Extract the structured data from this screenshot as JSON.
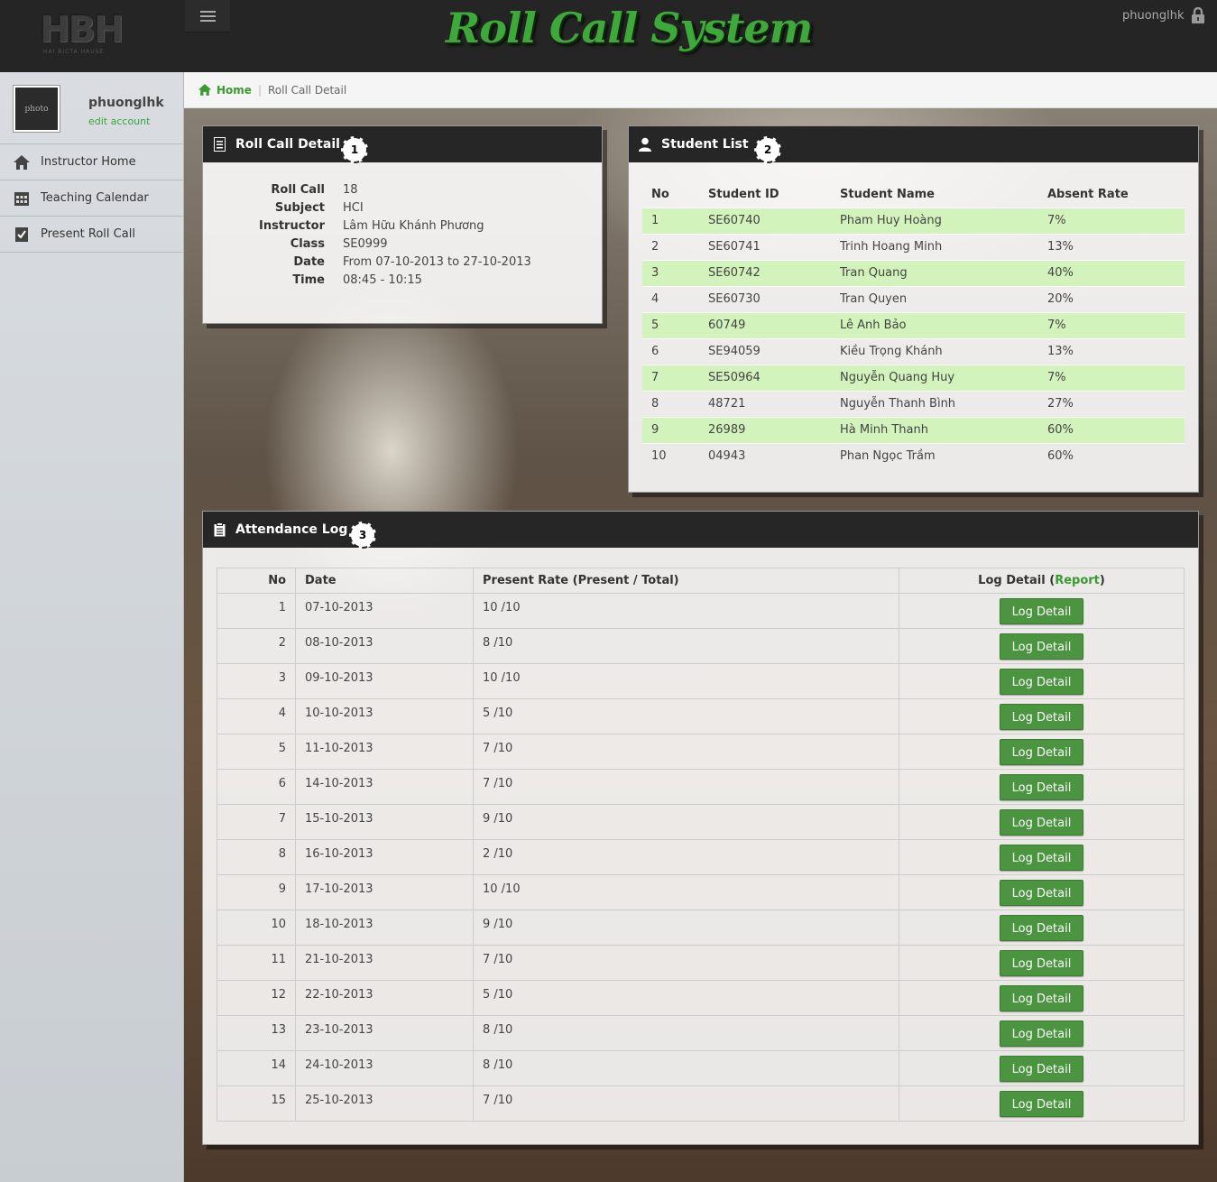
{
  "app": {
    "logo_text": "HBH",
    "logo_sub": "HAI BICTA HAUSE",
    "title": "Roll Call System",
    "username": "phuonglhk"
  },
  "sidebar": {
    "photo_label": "photo",
    "name": "phuonglhk",
    "edit": "edit account",
    "items": [
      {
        "label": "Instructor Home",
        "icon": "home-icon"
      },
      {
        "label": "Teaching Calendar",
        "icon": "calendar-icon"
      },
      {
        "label": "Present Roll Call",
        "icon": "checklist-icon"
      }
    ]
  },
  "breadcrumb": {
    "home": "Home",
    "current": "Roll Call Detail"
  },
  "roll_call": {
    "title": "Roll Call Detail",
    "badge": "1",
    "rows": [
      {
        "k": "Roll Call",
        "v": "18"
      },
      {
        "k": "Subject",
        "v": "HCI"
      },
      {
        "k": "Instructor",
        "v": "Lâm Hữu Khánh Phương"
      },
      {
        "k": "Class",
        "v": "SE0999"
      },
      {
        "k": "Date",
        "v": "From 07-10-2013 to 27-10-2013"
      },
      {
        "k": "Time",
        "v": "08:45 - 10:15"
      }
    ]
  },
  "students": {
    "title": "Student List",
    "badge": "2",
    "headers": [
      "No",
      "Student ID",
      "Student Name",
      "Absent Rate"
    ],
    "rows": [
      [
        "1",
        "SE60740",
        "Pham Huy Hoàng",
        "7%"
      ],
      [
        "2",
        "SE60741",
        "Trinh Hoang Minh",
        "13%"
      ],
      [
        "3",
        "SE60742",
        "Tran Quang",
        "40%"
      ],
      [
        "4",
        "SE60730",
        "Tran Quyen",
        "20%"
      ],
      [
        "5",
        "60749",
        "Lê Anh Bảo",
        "7%"
      ],
      [
        "6",
        "SE94059",
        "Kiều Trọng Khánh",
        "13%"
      ],
      [
        "7",
        "SE50964",
        "Nguyễn Quang Huy",
        "7%"
      ],
      [
        "8",
        "48721",
        "Nguyễn Thanh Bình",
        "27%"
      ],
      [
        "9",
        "26989",
        "Hà Minh Thanh",
        "60%"
      ],
      [
        "10",
        "04943",
        "Phan Ngọc Trầm",
        "60%"
      ]
    ]
  },
  "attendance": {
    "title": "Attendance Log",
    "badge": "3",
    "headers": {
      "no": "No",
      "date": "Date",
      "rate": "Present Rate (Present / Total)",
      "log_prefix": "Log Detail (",
      "report": "Report",
      "log_suffix": ")"
    },
    "button_label": "Log Detail",
    "rows": [
      [
        "1",
        "07-10-2013",
        "10 /10"
      ],
      [
        "2",
        "08-10-2013",
        "8 /10"
      ],
      [
        "3",
        "09-10-2013",
        "10 /10"
      ],
      [
        "4",
        "10-10-2013",
        "5 /10"
      ],
      [
        "5",
        "11-10-2013",
        "7 /10"
      ],
      [
        "6",
        "14-10-2013",
        "7 /10"
      ],
      [
        "7",
        "15-10-2013",
        "9 /10"
      ],
      [
        "8",
        "16-10-2013",
        "2 /10"
      ],
      [
        "9",
        "17-10-2013",
        "10 /10"
      ],
      [
        "10",
        "18-10-2013",
        "9 /10"
      ],
      [
        "11",
        "21-10-2013",
        "7 /10"
      ],
      [
        "12",
        "22-10-2013",
        "5 /10"
      ],
      [
        "13",
        "23-10-2013",
        "8 /10"
      ],
      [
        "14",
        "24-10-2013",
        "8 /10"
      ],
      [
        "15",
        "25-10-2013",
        "7 /10"
      ]
    ]
  },
  "colors": {
    "accent_green": "#3fa83a",
    "button_green": "#4b9440",
    "row_highlight": "#d2f3bb",
    "header_dark": "#262626"
  }
}
